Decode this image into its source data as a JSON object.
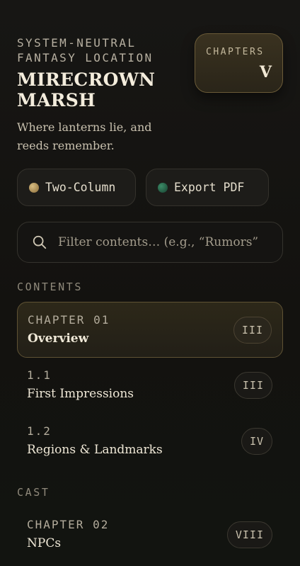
{
  "header": {
    "eyebrow": "SYSTEM-NEUTRAL\nFANTASY LOCATION",
    "title": "MIRECROWN\nMARSH",
    "subtitle": "Where lanterns lie, and reeds remember."
  },
  "chapters_card": {
    "label": "CHAPTERS",
    "value": "V"
  },
  "toolbar": {
    "two_column_label": "Two-Column",
    "export_label": "Export PDF",
    "two_column_dot_color": "#c8a86a",
    "export_dot_color": "#2f7a58"
  },
  "search": {
    "placeholder": "Filter contents… (e.g., “Rumors”",
    "value": ""
  },
  "sections": {
    "contents_label": "CONTENTS",
    "cast_label": "CAST"
  },
  "toc": [
    {
      "meta": "CHAPTER 01",
      "name": "Overview",
      "page": "III",
      "active": true
    },
    {
      "meta": "1.1",
      "name": "First Impressions",
      "page": "III",
      "active": false
    },
    {
      "meta": "1.2",
      "name": "Regions & Landmarks",
      "page": "IV",
      "active": false
    },
    {
      "meta": "CHAPTER 02",
      "name": "NPCs",
      "page": "VIII",
      "active": false
    }
  ],
  "colors": {
    "accent_gold": "#c8a86a",
    "background": "#141311",
    "text": "#e9e2d2"
  }
}
